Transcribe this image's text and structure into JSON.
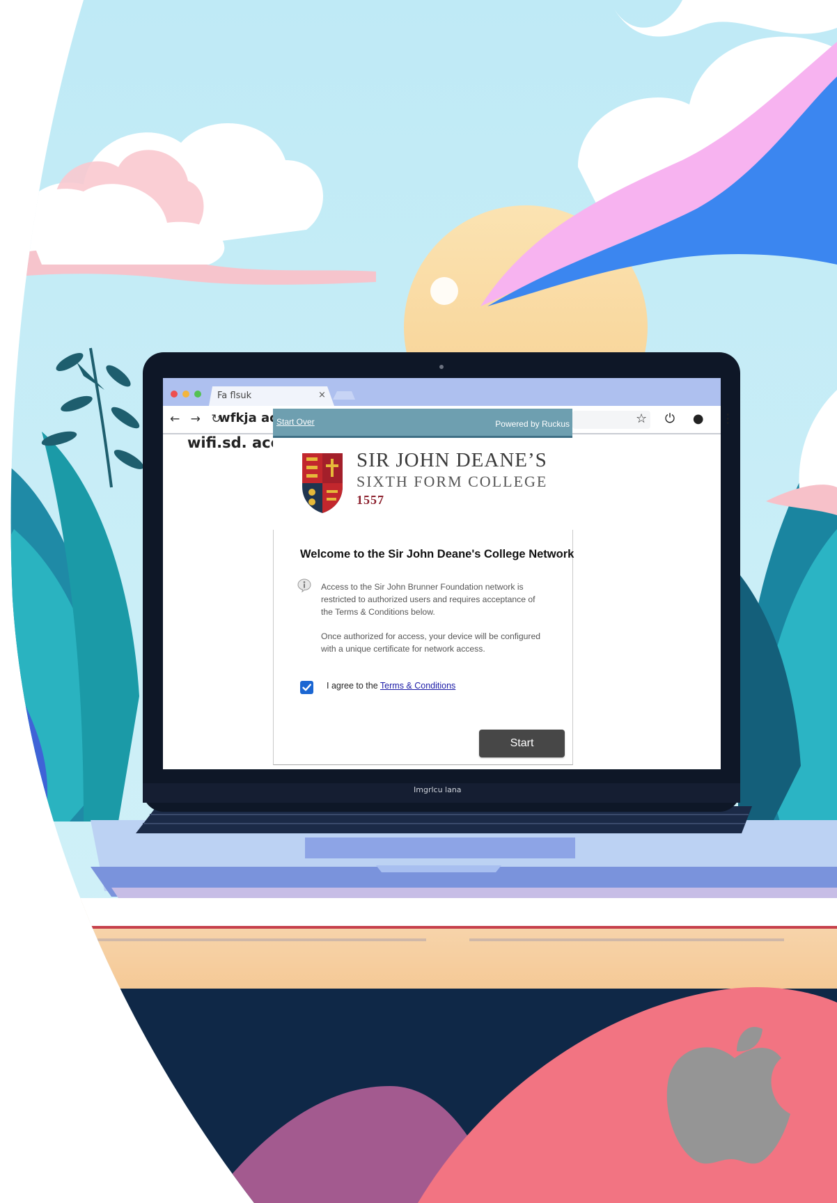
{
  "browser": {
    "tab_title": "Fa flsuk",
    "tab_close": "×",
    "nav_icons": "← → ↻",
    "url_partial": "wfkja ac",
    "url_overlay": "wifi.sd. acc",
    "toolbar_icons": "☆ ⏻ ● ⋮",
    "bezel_label": "Imgrlcu lana"
  },
  "portal": {
    "start_over_label": "Start Over",
    "powered_by": "Powered by Ruckus",
    "college_name_line1": "SIR JOHN DEANE’S",
    "college_name_line2": "SIXTH FORM COLLEGE",
    "college_year": "1557",
    "welcome_heading": "Welcome to the Sir John Deane's College Network",
    "info_text_1": "Access to the Sir John Brunner Foundation network is restricted to authorized users and requires acceptance of the Terms & Conditions below.",
    "info_text_2": "Once authorized for access, your device will be configured with a unique certificate for network access.",
    "agree_prefix": "I agree to the ",
    "terms_link": "Terms & Conditions",
    "agree_checked": true,
    "start_button": "Start"
  },
  "icons": {
    "info": "info-icon",
    "checkbox": "checkmark-icon",
    "brand": "apple-logo-icon",
    "crest": "college-crest-icon"
  },
  "colors": {
    "portal_bar": "#6e9fb0",
    "start_button": "#474747",
    "checkbox": "#1b66d2",
    "link": "#1a1aa6",
    "year": "#8b1f2c"
  }
}
